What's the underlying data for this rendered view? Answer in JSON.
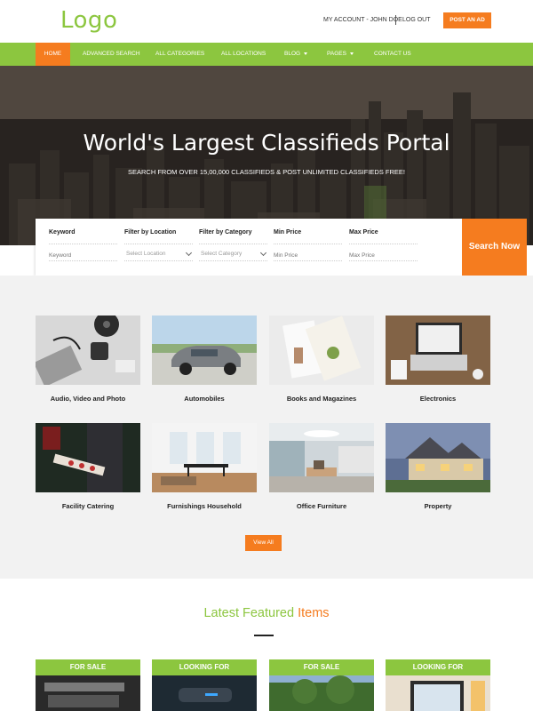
{
  "header": {
    "logo": "Logo",
    "account": "MY ACCOUNT - JOHN DOE",
    "logout": "LOG OUT",
    "post_ad": "POST AN AD"
  },
  "nav": {
    "items": [
      {
        "label": "HOME",
        "active": true
      },
      {
        "label": "ADVANCED SEARCH"
      },
      {
        "label": "ALL CATEGORIES"
      },
      {
        "label": "ALL LOCATIONS"
      },
      {
        "label": "BLOG",
        "dropdown": true
      },
      {
        "label": "PAGES",
        "dropdown": true
      },
      {
        "label": "CONTACT US"
      }
    ]
  },
  "hero": {
    "title": "World's Largest Classifieds Portal",
    "subtitle": "SEARCH FROM OVER 15,00,000 CLASSIFIEDS & POST UNLIMITED CLASSIFIEDS FREE!"
  },
  "search": {
    "fields": [
      {
        "label": "Keyword",
        "placeholder": "Keyword"
      },
      {
        "label": "Filter by Location",
        "value": "Select Location"
      },
      {
        "label": "Filter by Category",
        "value": "Select Category"
      },
      {
        "label": "Min Price",
        "placeholder": "Min Price"
      },
      {
        "label": "Max Price",
        "placeholder": "Max Price"
      }
    ],
    "button": "Search Now"
  },
  "categories": [
    {
      "label": "Audio, Video and Photo",
      "icon": "audio-video-photo"
    },
    {
      "label": "Automobiles",
      "icon": "car"
    },
    {
      "label": "Books and Magazines",
      "icon": "books"
    },
    {
      "label": "Electronics",
      "icon": "laptop"
    },
    {
      "label": "Facility Catering",
      "icon": "catering"
    },
    {
      "label": "Furnishings Household",
      "icon": "furniture"
    },
    {
      "label": "Office Furniture",
      "icon": "office"
    },
    {
      "label": "Property",
      "icon": "house"
    }
  ],
  "view_all": "View All",
  "featured": {
    "title_part1": "Latest Featured",
    "title_part2": "Items",
    "cards": [
      {
        "tag": "FOR SALE"
      },
      {
        "tag": "LOOKING FOR"
      },
      {
        "tag": "FOR SALE"
      },
      {
        "tag": "LOOKING FOR"
      }
    ]
  },
  "colors": {
    "accent_green": "#8cc63f",
    "accent_orange": "#f57c1f"
  }
}
